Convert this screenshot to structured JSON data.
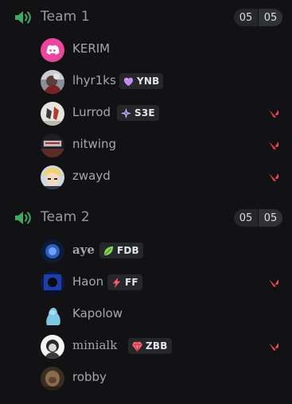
{
  "colors": {
    "background": "#121214",
    "speaker_green": "#3fa95f",
    "valorant_red": "#ff4655",
    "counter_bg": "#26272b"
  },
  "icons": {
    "channel": "speaker-volume-icon",
    "game": "valorant-icon"
  },
  "channels": [
    {
      "name": "Team 1",
      "user_count": "05",
      "user_limit": "05",
      "members": [
        {
          "name": "KERIM",
          "avatar": "discord-default-avatar",
          "tag": null,
          "in_game": false
        },
        {
          "name": "lhyr1ks",
          "avatar": "user-avatar",
          "tag": {
            "icon": "purple-heart-icon",
            "text": "YNB"
          },
          "in_game": false
        },
        {
          "name": "Lurrod",
          "avatar": "user-avatar",
          "tag": {
            "icon": "sparkle-star-icon",
            "text": "S3E"
          },
          "in_game": true
        },
        {
          "name": "nitwing",
          "avatar": "user-avatar",
          "tag": null,
          "in_game": true
        },
        {
          "name": "zwayd",
          "avatar": "user-avatar",
          "tag": null,
          "in_game": true
        }
      ]
    },
    {
      "name": "Team 2",
      "user_count": "05",
      "user_limit": "05",
      "members": [
        {
          "name": "aye",
          "avatar": "user-avatar",
          "tag": {
            "icon": "leaf-icon",
            "text": "FDB"
          },
          "in_game": false
        },
        {
          "name": "Haon",
          "avatar": "user-avatar",
          "tag": {
            "icon": "lightning-icon",
            "text": "FF"
          },
          "in_game": true
        },
        {
          "name": "Kapolow",
          "avatar": "user-avatar",
          "tag": null,
          "in_game": false
        },
        {
          "name": "minialk",
          "avatar": "user-avatar",
          "tag": {
            "icon": "gem-icon",
            "text": "ZBB"
          },
          "in_game": true
        },
        {
          "name": "robby",
          "avatar": "user-avatar",
          "tag": null,
          "in_game": false
        }
      ]
    }
  ]
}
